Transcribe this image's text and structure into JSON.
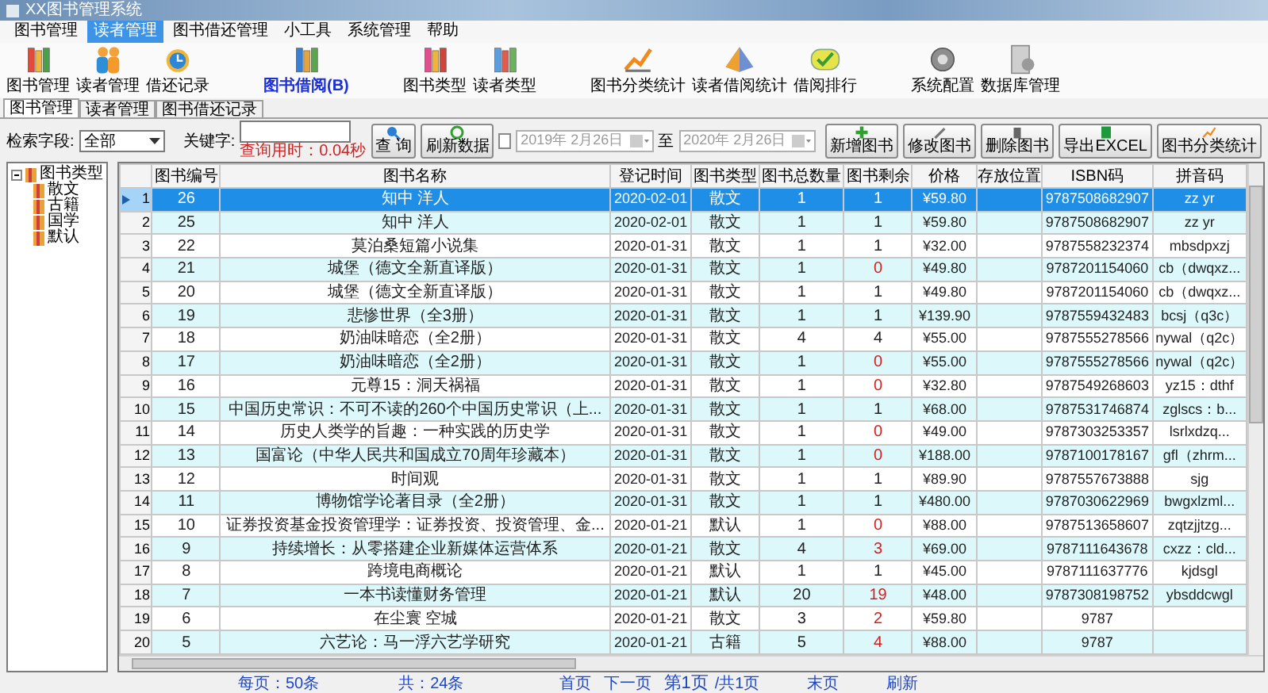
{
  "window": {
    "title": "XX图书管理系统"
  },
  "menu": [
    {
      "label": "图书管理",
      "selected": false
    },
    {
      "label": "读者管理",
      "selected": true
    },
    {
      "label": "图书借还管理",
      "selected": false
    },
    {
      "label": "小工具",
      "selected": false
    },
    {
      "label": "系统管理",
      "selected": false
    },
    {
      "label": "帮助",
      "selected": false
    }
  ],
  "toolbar": [
    {
      "items": [
        {
          "label": "图书管理",
          "highlighted": false
        },
        {
          "label": "读者管理",
          "highlighted": false
        },
        {
          "label": "借还记录",
          "highlighted": false
        }
      ]
    },
    {
      "items": [
        {
          "label": "图书借阅(B)",
          "highlighted": true
        }
      ]
    },
    {
      "items": [
        {
          "label": "图书类型",
          "highlighted": false
        },
        {
          "label": "读者类型",
          "highlighted": false
        }
      ]
    },
    {
      "items": [
        {
          "label": "图书分类统计",
          "highlighted": false
        },
        {
          "label": "读者借阅统计",
          "highlighted": false
        },
        {
          "label": "借阅排行",
          "highlighted": false
        }
      ]
    },
    {
      "items": [
        {
          "label": "系统配置",
          "highlighted": false
        },
        {
          "label": "数据库管理",
          "highlighted": false
        }
      ]
    }
  ],
  "tabs": [
    {
      "label": "图书管理",
      "selected": true
    },
    {
      "label": "读者管理",
      "selected": false
    },
    {
      "label": "图书借还记录",
      "selected": false
    }
  ],
  "search": {
    "field_label": "检索字段:",
    "field_value": "全部",
    "keyword_label": "关键字:",
    "query_time": "查询用时：0.04秒",
    "query_button": "查 询",
    "refresh_button": "刷新数据",
    "date_enabled": false,
    "date_from": "2019年 2月26日",
    "date_to_label": "至",
    "date_to": "2020年 2月26日"
  },
  "actions": [
    "新增图书",
    "修改图书",
    "删除图书",
    "导出EXCEL",
    "图书分类统计"
  ],
  "tree": {
    "label": "图书类型",
    "expanded": true,
    "children": [
      {
        "label": "散文"
      },
      {
        "label": "古籍"
      },
      {
        "label": "国学"
      },
      {
        "label": "默认"
      }
    ]
  },
  "table": {
    "columns": [
      "图书编号",
      "图书名称",
      "登记时间",
      "图书类型",
      "图书总数量",
      "图书剩余",
      "价格",
      "存放位置",
      "ISBN码",
      "拼音码"
    ],
    "rows": [
      {
        "no": "1",
        "selected": true,
        "short": false,
        "cells": [
          "26",
          "知中 洋人",
          "2020-02-01",
          "散文",
          "1",
          "1",
          "¥59.80",
          "",
          "9787508682907",
          "zz yr"
        ]
      },
      {
        "no": "2",
        "selected": false,
        "short": false,
        "cells": [
          "25",
          "知中 洋人",
          "2020-02-01",
          "散文",
          "1",
          "1",
          "¥59.80",
          "",
          "9787508682907",
          "zz yr"
        ]
      },
      {
        "no": "3",
        "selected": false,
        "short": false,
        "cells": [
          "22",
          "莫泊桑短篇小说集",
          "2020-01-31",
          "散文",
          "1",
          "1",
          "¥32.00",
          "",
          "9787558232374",
          "mbsdpxzj"
        ]
      },
      {
        "no": "4",
        "selected": false,
        "short": true,
        "cells": [
          "21",
          "城堡（德文全新直译版）",
          "2020-01-31",
          "散文",
          "1",
          "0",
          "¥49.80",
          "",
          "9787201154060",
          "cb（dwqxz..."
        ]
      },
      {
        "no": "5",
        "selected": false,
        "short": false,
        "cells": [
          "20",
          "城堡（德文全新直译版）",
          "2020-01-31",
          "散文",
          "1",
          "1",
          "¥49.80",
          "",
          "9787201154060",
          "cb（dwqxz..."
        ]
      },
      {
        "no": "6",
        "selected": false,
        "short": false,
        "cells": [
          "19",
          "悲惨世界（全3册）",
          "2020-01-31",
          "散文",
          "1",
          "1",
          "¥139.90",
          "",
          "9787559432483",
          "bcsj（q3c）"
        ]
      },
      {
        "no": "7",
        "selected": false,
        "short": false,
        "cells": [
          "18",
          "奶油味暗恋（全2册）",
          "2020-01-31",
          "散文",
          "4",
          "4",
          "¥55.00",
          "",
          "9787555278566",
          "nywal（q2c）"
        ]
      },
      {
        "no": "8",
        "selected": false,
        "short": true,
        "cells": [
          "17",
          "奶油味暗恋（全2册）",
          "2020-01-31",
          "散文",
          "1",
          "0",
          "¥55.00",
          "",
          "9787555278566",
          "nywal（q2c）"
        ]
      },
      {
        "no": "9",
        "selected": false,
        "short": true,
        "cells": [
          "16",
          "元尊15：洞天祸福",
          "2020-01-31",
          "散文",
          "1",
          "0",
          "¥32.80",
          "",
          "9787549268603",
          "yz15：dthf"
        ]
      },
      {
        "no": "10",
        "selected": false,
        "short": false,
        "cells": [
          "15",
          "中国历史常识：不可不读的260个中国历史常识（上...",
          "2020-01-31",
          "散文",
          "1",
          "1",
          "¥68.00",
          "",
          "9787531746874",
          "zglscs：b..."
        ]
      },
      {
        "no": "11",
        "selected": false,
        "short": true,
        "cells": [
          "14",
          "历史人类学的旨趣：一种实践的历史学",
          "2020-01-31",
          "散文",
          "1",
          "0",
          "¥49.00",
          "",
          "9787303253357",
          "lsrlxdzq..."
        ]
      },
      {
        "no": "12",
        "selected": false,
        "short": true,
        "cells": [
          "13",
          "国富论（中华人民共和国成立70周年珍藏本）",
          "2020-01-31",
          "散文",
          "1",
          "0",
          "¥188.00",
          "",
          "9787100178167",
          "gfl（zhrm..."
        ]
      },
      {
        "no": "13",
        "selected": false,
        "short": false,
        "cells": [
          "12",
          "时间观",
          "2020-01-31",
          "散文",
          "1",
          "1",
          "¥89.90",
          "",
          "9787557673888",
          "sjg"
        ]
      },
      {
        "no": "14",
        "selected": false,
        "short": false,
        "cells": [
          "11",
          "博物馆学论著目录（全2册）",
          "2020-01-31",
          "散文",
          "1",
          "1",
          "¥480.00",
          "",
          "9787030622969",
          "bwgxlzml..."
        ]
      },
      {
        "no": "15",
        "selected": false,
        "short": true,
        "cells": [
          "10",
          "证券投资基金投资管理学：证券投资、投资管理、金...",
          "2020-01-21",
          "默认",
          "1",
          "0",
          "¥88.00",
          "",
          "9787513658607",
          "zqtzjjtzg..."
        ]
      },
      {
        "no": "16",
        "selected": false,
        "short": true,
        "cells": [
          "9",
          "持续增长：从零搭建企业新媒体运营体系",
          "2020-01-21",
          "散文",
          "4",
          "3",
          "¥69.00",
          "",
          "9787111643678",
          "cxzz：cld..."
        ]
      },
      {
        "no": "17",
        "selected": false,
        "short": false,
        "cells": [
          "8",
          "跨境电商概论",
          "2020-01-21",
          "默认",
          "1",
          "1",
          "¥45.00",
          "",
          "9787111637776",
          "kjdsgl"
        ]
      },
      {
        "no": "18",
        "selected": false,
        "short": true,
        "cells": [
          "7",
          "一本书读懂财务管理",
          "2020-01-21",
          "默认",
          "20",
          "19",
          "¥48.00",
          "",
          "9787308198752",
          "ybsddcwgl"
        ]
      },
      {
        "no": "19",
        "selected": false,
        "short": true,
        "cells": [
          "6",
          "在尘寰 空城",
          "2020-01-21",
          "散文",
          "3",
          "2",
          "¥59.80",
          "",
          "9787",
          ""
        ]
      },
      {
        "no": "20",
        "selected": false,
        "short": true,
        "cells": [
          "5",
          "六艺论：马一浮六艺学研究",
          "2020-01-21",
          "古籍",
          "5",
          "4",
          "¥88.00",
          "",
          "9787",
          ""
        ]
      }
    ]
  },
  "status_bar": {
    "page_size": "每页：50条",
    "total": "共：24条",
    "first": "首页",
    "prev": "下一页",
    "page": "第1页",
    "pages": "/共1页",
    "last": "末页",
    "refresh": "刷新"
  }
}
